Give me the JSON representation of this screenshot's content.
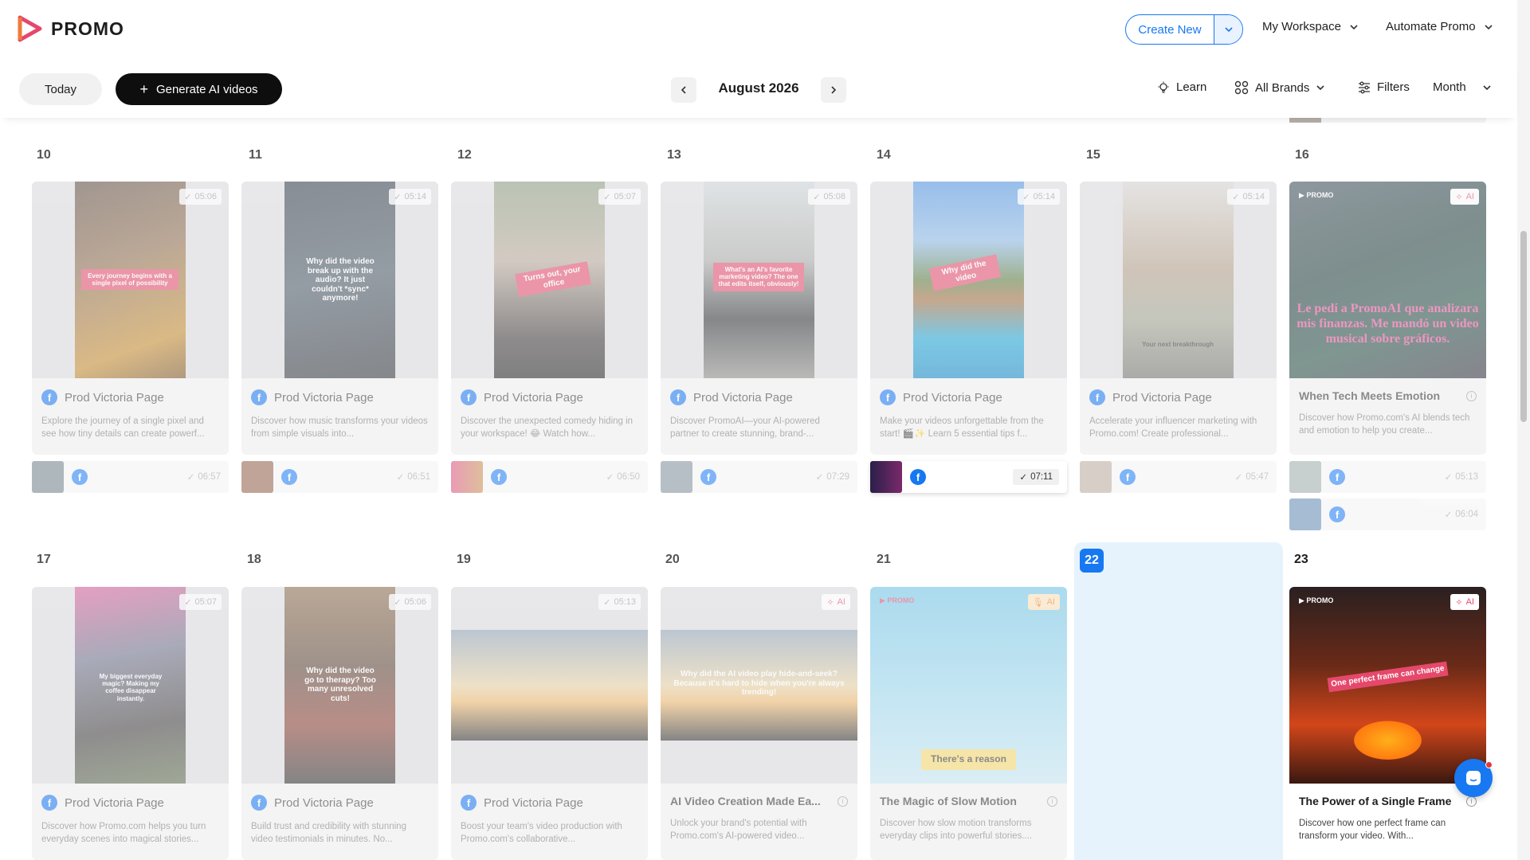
{
  "header": {
    "logo_text": "PROMO",
    "create_new": "Create New",
    "workspace": "My Workspace",
    "automate": "Automate Promo"
  },
  "toolbar": {
    "today": "Today",
    "generate": "Generate AI videos",
    "month_title": "August 2026",
    "learn": "Learn",
    "brands": "All Brands",
    "filters": "Filters",
    "view": "Month"
  },
  "week1": {
    "days": [
      "10",
      "11",
      "12",
      "13",
      "14",
      "15",
      "16"
    ],
    "cards": [
      {
        "page": "Prod Victoria Page",
        "duration": "05:06",
        "desc": "Explore the journey of a single pixel and see how tiny details can create powerf...",
        "overlay": "Every journey begins with a single pixel of possibility",
        "mini_duration": "06:57"
      },
      {
        "page": "Prod Victoria Page",
        "duration": "05:14",
        "desc": "Discover how music transforms your videos from simple visuals into...",
        "overlay": "Why did the video break up with the audio? It just couldn't *sync* anymore!",
        "mini_duration": "06:51"
      },
      {
        "page": "Prod Victoria Page",
        "duration": "05:07",
        "desc": "Discover the unexpected comedy hiding in your workspace! 😂 Watch how...",
        "overlay": "Turns out, your office",
        "mini_duration": "06:50"
      },
      {
        "page": "Prod Victoria Page",
        "duration": "05:08",
        "desc": "Discover PromoAI—your AI-powered partner to create stunning, brand-...",
        "overlay": "What's an AI's favorite marketing video? The one that edits itself, obviously!",
        "mini_duration": "07:29"
      },
      {
        "page": "Prod Victoria Page",
        "duration": "05:14",
        "desc": "Make your videos unforgettable from the start! 🎬✨ Learn 5 essential tips f...",
        "overlay": "Why did the video",
        "mini_duration": "07:11"
      },
      {
        "page": "Prod Victoria Page",
        "duration": "05:14",
        "desc": "Accelerate your influencer marketing with Promo.com! Create professional...",
        "overlay": "Your next breakthrough",
        "mini_duration": "05:47"
      },
      {
        "title": "When Tech Meets Emotion",
        "ai": "AI",
        "desc": "Discover how Promo.com's AI blends tech and emotion to help you create...",
        "overlay": "Le pedí a PromoAI que analizara mis finanzas. Me mandó un video musical sobre gráficos.",
        "mini_duration": "05:13",
        "mini_duration_2": "06:04"
      }
    ]
  },
  "week2": {
    "days": [
      "17",
      "18",
      "19",
      "20",
      "21",
      "22",
      "23"
    ],
    "cards": [
      {
        "page": "Prod Victoria Page",
        "duration": "05:07",
        "desc": "Discover how Promo.com helps you turn everyday scenes into magical stories...",
        "overlay": "My biggest everyday magic? Making my coffee disappear instantly."
      },
      {
        "page": "Prod Victoria Page",
        "duration": "05:06",
        "desc": "Build trust and credibility with stunning video testimonials in minutes. No...",
        "overlay": "Why did the video go to therapy? Too many unresolved cuts!"
      },
      {
        "page": "Prod Victoria Page",
        "duration": "05:13",
        "desc": "Boost your team's video production with Promo.com's collaborative...",
        "overlay": ""
      },
      {
        "title": "AI Video Creation Made Ea...",
        "ai": "AI",
        "desc": "Unlock your brand's potential with Promo.com's AI-powered video...",
        "overlay": "Why did the AI video play hide-and-seek? Because it's hard to hide when you're always trending!"
      },
      {
        "title": "The Magic of Slow Motion",
        "ai": "AI",
        "desc": "Discover how slow motion transforms everyday clips into powerful stories....",
        "overlay": "There's a reason"
      },
      {},
      {
        "title": "The Power of a Single Frame",
        "ai": "AI",
        "desc": "Discover how one perfect frame can transform your video. With...",
        "overlay": "One perfect frame can change"
      }
    ]
  },
  "colors": {
    "accent": "#1778f2",
    "brand": "#e5486b",
    "today_bg": "#e6f3fc"
  }
}
